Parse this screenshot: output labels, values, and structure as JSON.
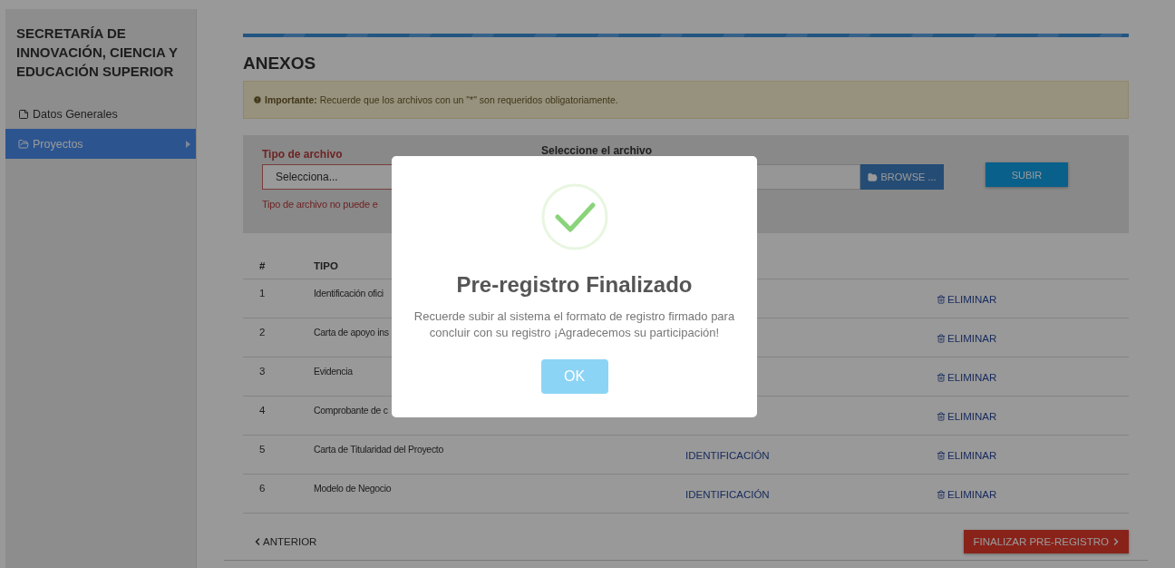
{
  "sidebar": {
    "title": "SECRETARÍA DE INNOVACIÓN, CIENCIA Y EDUCACIÓN SUPERIOR",
    "items": [
      {
        "label": "Datos Generales",
        "selected": false
      },
      {
        "label": "Proyectos",
        "selected": true
      }
    ]
  },
  "heading": "ANEXOS",
  "alert": "**Importante:** Recuerde que los archivos con un \"*\" son requeridos obligatoriamente.",
  "upload": {
    "type_label": "Tipo de archivo",
    "select_placeholder": "Selecciona...",
    "error": "Tipo de archivo no puede e",
    "file_label": "Seleccione el archivo",
    "browse": "BROWSE ...",
    "submit": "SUBIR"
  },
  "table": {
    "columns": [
      "#",
      "TIPO"
    ],
    "rows": [
      {
        "number": "1",
        "type": "Identificación ofici",
        "action": "ELIMINAR"
      },
      {
        "number": "2",
        "type": "Carta de apoyo ins",
        "action": "ELIMINAR"
      },
      {
        "number": "3",
        "type": "Evidencia",
        "action": "ELIMINAR"
      },
      {
        "number": "4",
        "type": "Comprobante de c",
        "action": "ELIMINAR"
      },
      {
        "number": "5",
        "type": "Carta de Titularidad del Proyecto",
        "column_3": "IDENTIFICACIÓN",
        "action": "ELIMINAR"
      },
      {
        "number": "6",
        "type": "Modelo de Negocio",
        "column_3": "IDENTIFICACIÓN",
        "action": "ELIMINAR"
      }
    ]
  },
  "nav": {
    "previous": "ANTERIOR",
    "finish": "FINALIZAR PRE-REGISTRO"
  },
  "modal": {
    "title": "Pre-registro Finalizado",
    "message": "Recuerde subir al sistema el formato de registro firmado para concluir con su registro ¡Agradecemos su participación!",
    "ok": "OK"
  }
}
